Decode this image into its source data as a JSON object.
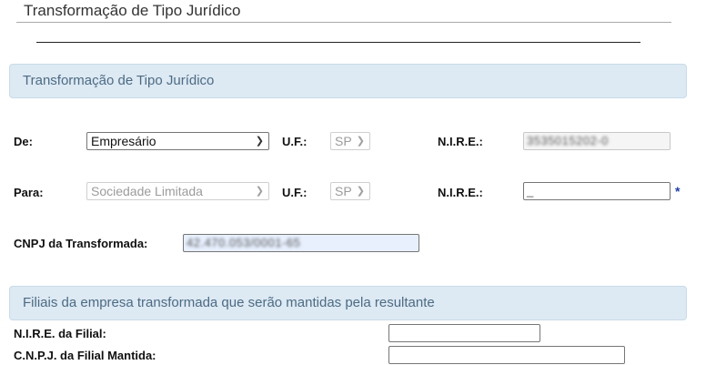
{
  "page": {
    "title": "Transformação de Tipo Jurídico"
  },
  "section_main": {
    "header": "Transformação de Tipo Jurídico",
    "row_de": {
      "label": "De:",
      "select_value": "Empresário",
      "uf_label": "U.F.:",
      "uf_value": "SP",
      "nire_label": "N.I.R.E.:",
      "nire_value": "3535015202-0"
    },
    "row_para": {
      "label": "Para:",
      "select_value": "Sociedade Limitada",
      "uf_label": "U.F.:",
      "uf_value": "SP",
      "nire_label": "N.I.R.E.:",
      "nire_value": "_",
      "required_mark": "*"
    },
    "cnpj": {
      "label": "CNPJ da Transformada:",
      "value": "42.470.053/0001-65"
    }
  },
  "section_filiais": {
    "header": "Filiais da empresa transformada que serão mantidas pela resultante",
    "nire_filial_label": "N.I.R.E. da Filial:",
    "nire_filial_value": "",
    "cnpj_filial_label": "C.N.P.J. da Filial Mantida:",
    "cnpj_filial_value": ""
  },
  "icons": {
    "dropdown": "chevron-down-icon"
  },
  "colors": {
    "section_header_bg": "#dde9f3",
    "section_header_text": "#4c6b84",
    "required_mark": "#1e3fa8",
    "autofill_bg": "#e8f0fe"
  }
}
